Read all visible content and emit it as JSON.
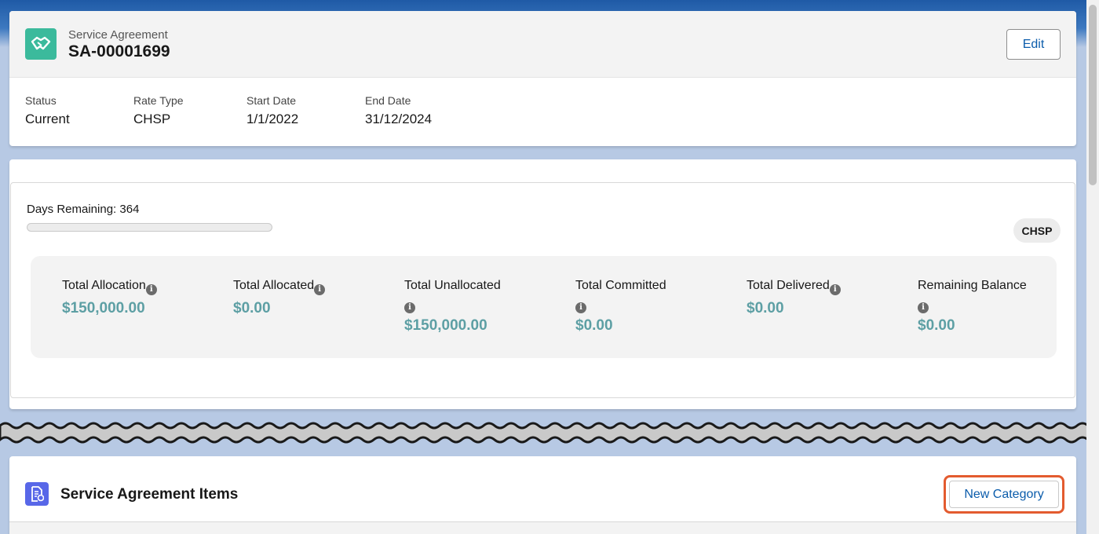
{
  "header": {
    "record_type": "Service Agreement",
    "record_name": "SA-00001699",
    "edit_label": "Edit",
    "icon": "handshake-icon",
    "icon_color": "#3bba9c"
  },
  "fields": [
    {
      "label": "Status",
      "value": "Current"
    },
    {
      "label": "Rate Type",
      "value": "CHSP"
    },
    {
      "label": "Start Date",
      "value": "1/1/2022"
    },
    {
      "label": "End Date",
      "value": "31/12/2024"
    }
  ],
  "summary": {
    "days_remaining_label": "Days Remaining: 364",
    "progress_fraction": 0,
    "badge": "CHSP",
    "metrics": [
      {
        "label": "Total Allocation",
        "value": "$150,000.00"
      },
      {
        "label": "Total Allocated",
        "value": "$0.00"
      },
      {
        "label": "Total Unallocated",
        "value": "$150,000.00"
      },
      {
        "label": "Total Committed",
        "value": "$0.00"
      },
      {
        "label": "Total Delivered",
        "value": "$0.00"
      },
      {
        "label": "Remaining Balance",
        "value": "$0.00"
      }
    ],
    "value_color": "#5d9fa4"
  },
  "items": {
    "title": "Service Agreement Items",
    "new_category_label": "New Category",
    "icon": "document-icon",
    "icon_color": "#5867e8",
    "highlight_color": "#e35b2f"
  }
}
